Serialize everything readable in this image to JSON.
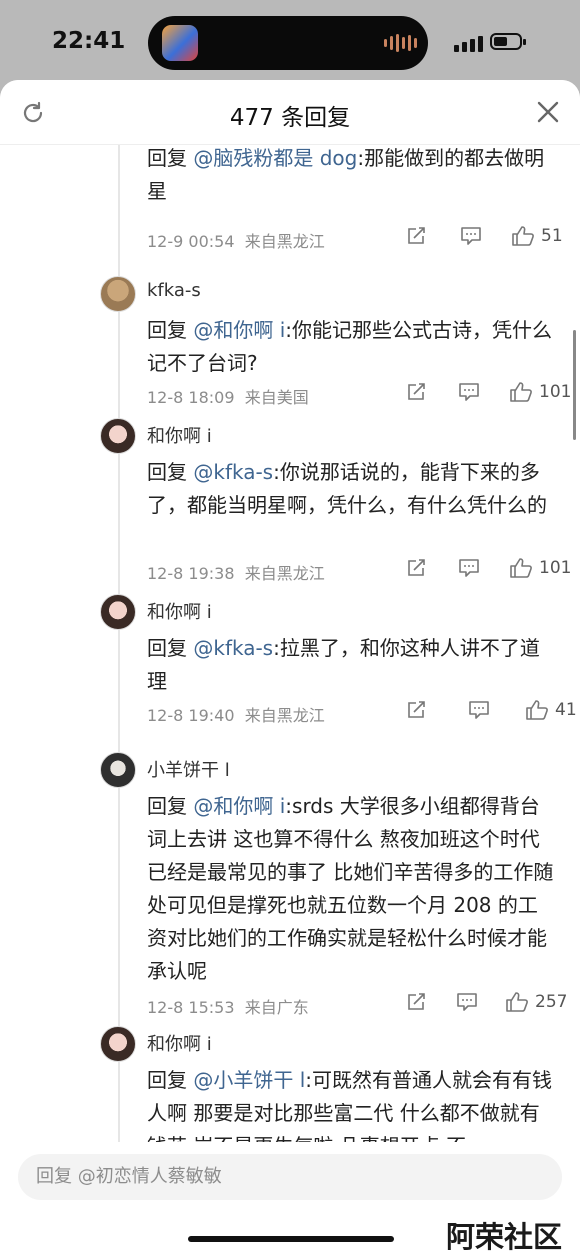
{
  "status_bar": {
    "time": "22:41"
  },
  "header": {
    "title": "477 条回复"
  },
  "replies": [
    {
      "user": "",
      "prefix": "回复 ",
      "mention": "@脑残粉都是 dog",
      "text": ":那能做到的都去做明星",
      "date": "12-9 00:54",
      "location": "来自黑龙江",
      "likes": "51"
    },
    {
      "user": "kfka-s",
      "prefix": "回复 ",
      "mention": "@和你啊 i",
      "text": ":你能记那些公式古诗，凭什么记不了台词?",
      "date": "12-8 18:09",
      "location": "来自美国",
      "likes": "101"
    },
    {
      "user": "和你啊 i",
      "prefix": "回复 ",
      "mention": "@kfka-s",
      "text": ":你说那话说的，能背下来的多了，都能当明星啊，凭什么，有什么凭什么的",
      "date": "12-8 19:38",
      "location": "来自黑龙江",
      "likes": "101"
    },
    {
      "user": "和你啊 i",
      "prefix": "回复 ",
      "mention": "@kfka-s",
      "text": ":拉黑了，和你这种人讲不了道理",
      "date": "12-8 19:40",
      "location": "来自黑龙江",
      "likes": "41"
    },
    {
      "user": "小羊饼干 l",
      "prefix": "回复 ",
      "mention": "@和你啊 i",
      "text": ":srds 大学很多小组都得背台词上去讲 这也算不得什么 熬夜加班这个时代已经是最常见的事了 比她们辛苦得多的工作随处可见但是撑死也就五位数一个月 208 的工资对比她们的工作确实就是轻松什么时候才能承认呢",
      "date": "12-8 15:53",
      "location": "来自广东",
      "likes": "257"
    },
    {
      "user": "和你啊 i",
      "prefix": "回复 ",
      "mention": "@小羊饼干 l",
      "text": ":可既然有普通人就会有有钱人啊 那要是对比那些富二代 什么都不做就有钱花 岂不是更生气啦 凡事想开点 不",
      "date": "",
      "location": "",
      "likes": ""
    }
  ],
  "reply_box": {
    "placeholder": "回复 @初恋情人蔡敏敏"
  },
  "watermark": "阿荣社区",
  "icons": {
    "refresh": "refresh-icon",
    "close": "close-icon",
    "share": "share-icon",
    "comment": "comment-icon",
    "like": "like-icon"
  },
  "colors": {
    "mention": "#3f6590",
    "meta": "#8c8c8c"
  }
}
